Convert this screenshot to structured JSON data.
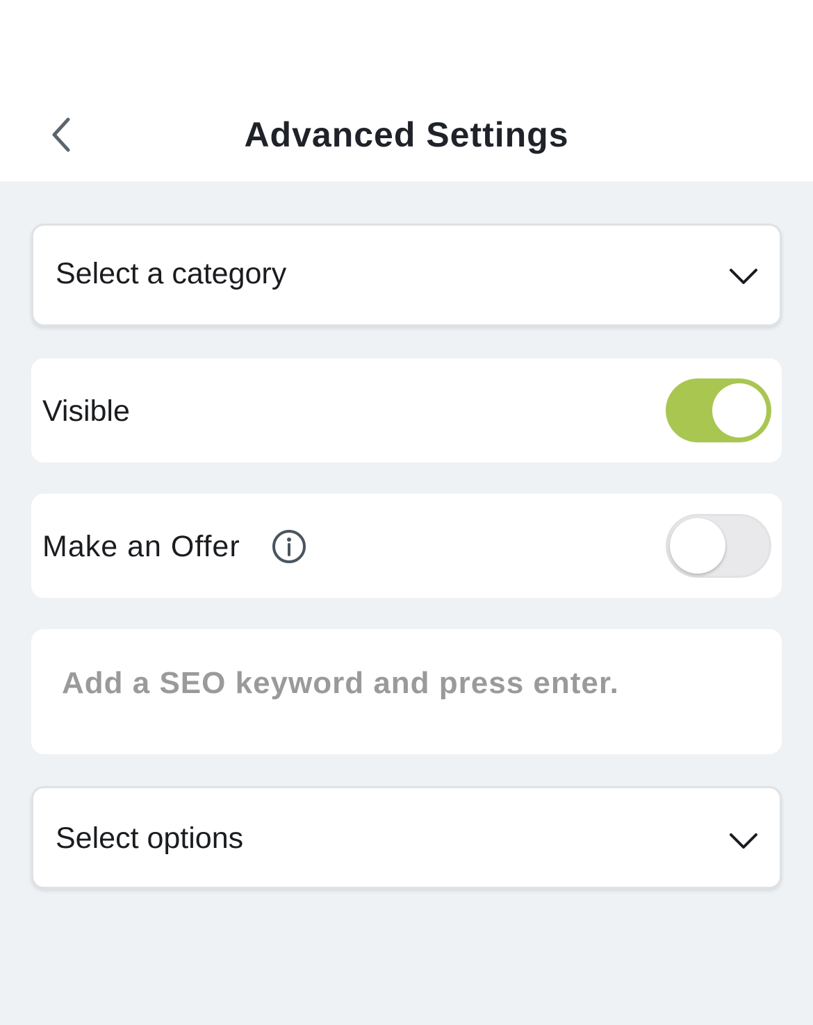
{
  "header": {
    "title": "Advanced Settings",
    "back_icon": "chevron-left-icon"
  },
  "category_select": {
    "selected_value": "Select a category",
    "icon": "chevron-down-icon"
  },
  "visible_toggle": {
    "label": "Visible",
    "checked": true,
    "on_color": "#a9c651"
  },
  "offer_toggle": {
    "label": "Make an Offer",
    "info_icon": "info-icon",
    "checked": false
  },
  "seo_keyword": {
    "value": "",
    "placeholder": "Add a SEO keyword and press enter."
  },
  "options_select": {
    "selected_value": "Select options",
    "icon": "chevron-down-icon"
  },
  "colors": {
    "background": "#eff2f4",
    "card": "#ffffff",
    "accent": "#a9c651",
    "title_text": "#1f2329",
    "placeholder_text": "#9a9a9a"
  }
}
